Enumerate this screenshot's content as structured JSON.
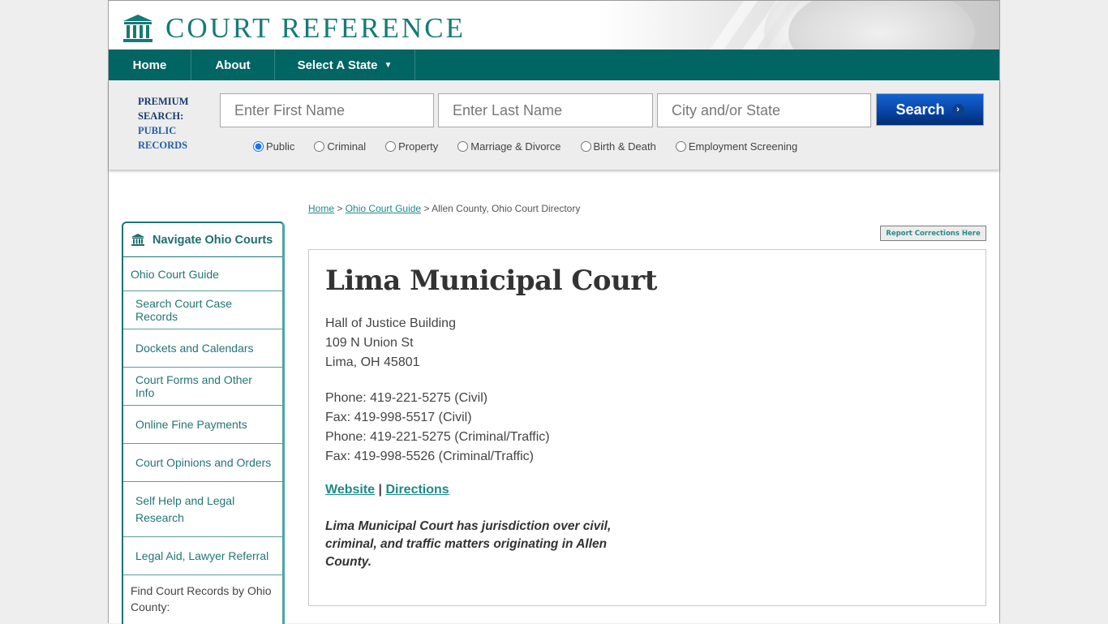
{
  "brand": {
    "name": "COURT REFERENCE",
    "logo_icon": "courthouse-icon",
    "color": "#167a76"
  },
  "nav": {
    "items": [
      {
        "label": "Home"
      },
      {
        "label": "About"
      },
      {
        "label": "Select A State",
        "icon": "caret-down-icon",
        "caret": "▼"
      }
    ],
    "bg_color": "#006563"
  },
  "search": {
    "premium_label_1": "PREMIUM",
    "premium_label_2": "SEARCH:",
    "premium_label_3": "PUBLIC",
    "premium_label_4": "RECORDS",
    "first_name": {
      "value": "",
      "placeholder": "Enter First Name"
    },
    "last_name": {
      "value": "",
      "placeholder": "Enter Last Name"
    },
    "location": {
      "value": "",
      "placeholder": "City and/or State"
    },
    "button_label": "Search",
    "button_icon": "chevron-right-icon",
    "record_types": [
      {
        "label": "Public",
        "checked": true
      },
      {
        "label": "Criminal",
        "checked": false
      },
      {
        "label": "Property",
        "checked": false
      },
      {
        "label": "Marriage & Divorce",
        "checked": false
      },
      {
        "label": "Birth & Death",
        "checked": false
      },
      {
        "label": "Employment Screening",
        "checked": false
      }
    ]
  },
  "breadcrumb": {
    "items": [
      {
        "label": "Home",
        "link": true
      },
      {
        "label": "Ohio Court Guide",
        "link": true
      },
      {
        "label": "Allen County, Ohio Court Directory",
        "link": false
      }
    ],
    "separator": ">"
  },
  "report_button": "Report Corrections Here",
  "sidebar": {
    "title": "Navigate Ohio Courts",
    "icon": "courthouse-icon",
    "items": [
      {
        "label": "Ohio Court Guide"
      },
      {
        "label": "Search Court Case Records"
      },
      {
        "label": "Dockets and Calendars"
      },
      {
        "label": "Court Forms and Other Info"
      },
      {
        "label": "Online Fine Payments"
      },
      {
        "label": "Court Opinions and Orders"
      },
      {
        "label": "Self Help and Legal Research"
      },
      {
        "label": "Legal Aid, Lawyer Referral"
      }
    ],
    "footer": "Find Court Records by Ohio County:"
  },
  "court": {
    "name": "Lima Municipal Court",
    "address": [
      "Hall of Justice Building",
      "109 N Union St",
      "Lima, OH 45801"
    ],
    "contacts": [
      "Phone: 419-221-5275 (Civil)",
      "Fax: 419-998-5517 (Civil)",
      "Phone: 419-221-5275 (Criminal/Traffic)",
      "Fax: 419-998-5526 (Criminal/Traffic)"
    ],
    "links": {
      "website": "Website",
      "separator": "|",
      "directions": "Directions"
    },
    "description": "Lima Municipal Court has jurisdiction over civil, criminal, and traffic matters originating in Allen County."
  }
}
